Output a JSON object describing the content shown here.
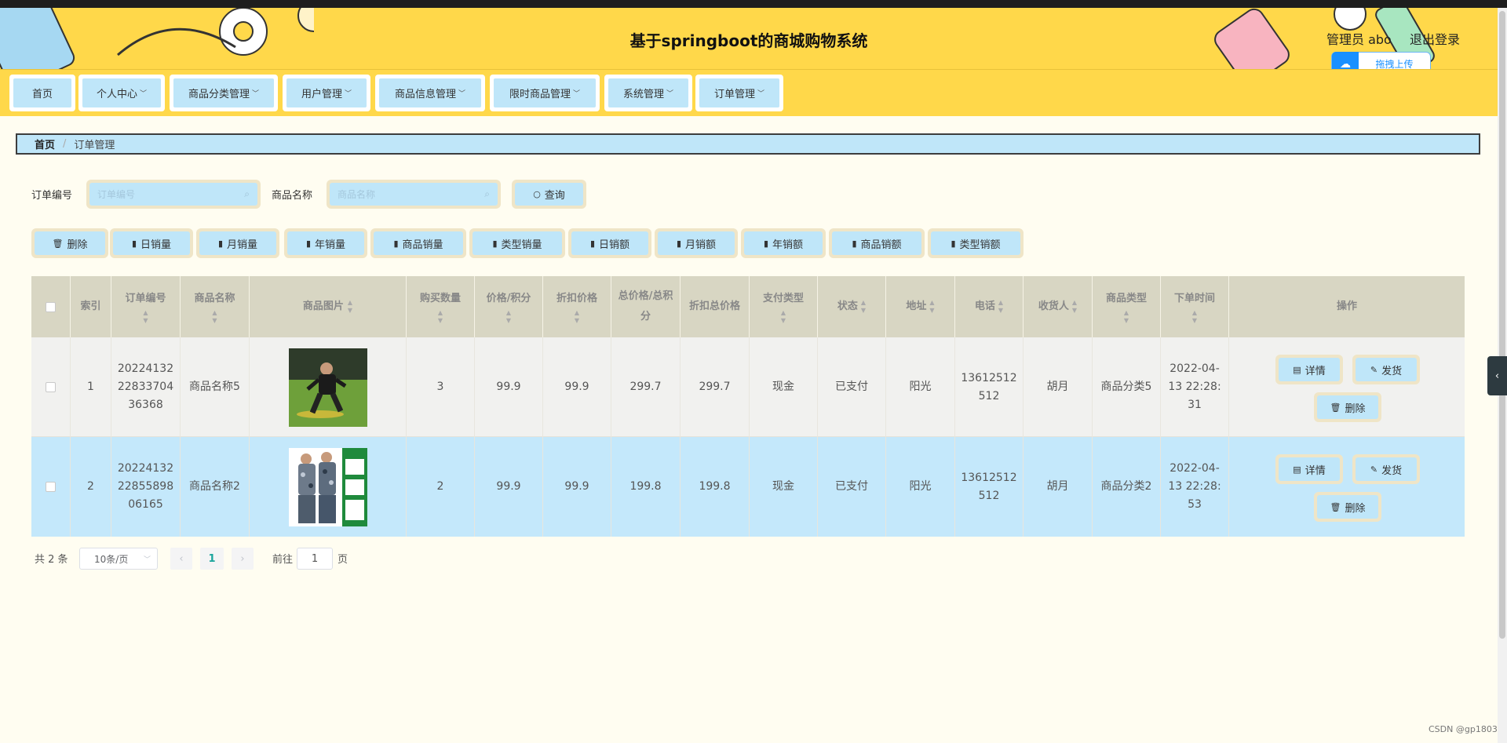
{
  "header": {
    "title": "基于springboot的商城购物系统",
    "user": "管理员 abo",
    "logout": "退出登录",
    "upload_label": "拖拽上传"
  },
  "nav": {
    "items": [
      {
        "label": "首页",
        "dropdown": false
      },
      {
        "label": "个人中心",
        "dropdown": true
      },
      {
        "label": "商品分类管理",
        "dropdown": true
      },
      {
        "label": "用户管理",
        "dropdown": true
      },
      {
        "label": "商品信息管理",
        "dropdown": true
      },
      {
        "label": "限时商品管理",
        "dropdown": true
      },
      {
        "label": "系统管理",
        "dropdown": true
      },
      {
        "label": "订单管理",
        "dropdown": true
      }
    ]
  },
  "breadcrumb": {
    "home": "首页",
    "separator": "/",
    "current": "订单管理"
  },
  "search": {
    "order_no_label": "订单编号",
    "order_no_placeholder": "订单编号",
    "product_name_label": "商品名称",
    "product_name_placeholder": "商品名称",
    "query_label": "查询"
  },
  "actions": {
    "buttons": [
      {
        "label": "删除",
        "icon": "trash-icon"
      },
      {
        "label": "日销量",
        "icon": "bar-chart-icon"
      },
      {
        "label": "月销量",
        "icon": "bar-chart-icon"
      },
      {
        "label": "年销量",
        "icon": "bar-chart-icon"
      },
      {
        "label": "商品销量",
        "icon": "bar-chart-icon"
      },
      {
        "label": "类型销量",
        "icon": "bar-chart-icon"
      },
      {
        "label": "日销额",
        "icon": "bar-chart-icon"
      },
      {
        "label": "月销额",
        "icon": "bar-chart-icon"
      },
      {
        "label": "年销额",
        "icon": "bar-chart-icon"
      },
      {
        "label": "商品销额",
        "icon": "bar-chart-icon"
      },
      {
        "label": "类型销额",
        "icon": "bar-chart-icon"
      }
    ]
  },
  "table": {
    "columns": [
      {
        "label": "",
        "sortable": false
      },
      {
        "label": "索引",
        "sortable": false
      },
      {
        "label": "订单编号",
        "sortable": true
      },
      {
        "label": "商品名称",
        "sortable": true
      },
      {
        "label": "商品图片",
        "sortable": true
      },
      {
        "label": "购买数量",
        "sortable": true
      },
      {
        "label": "价格/积分",
        "sortable": true
      },
      {
        "label": "折扣价格",
        "sortable": true
      },
      {
        "label": "总价格/总积分",
        "sortable": true
      },
      {
        "label": "折扣总价格",
        "sortable": true
      },
      {
        "label": "支付类型",
        "sortable": true
      },
      {
        "label": "状态",
        "sortable": true
      },
      {
        "label": "地址",
        "sortable": true
      },
      {
        "label": "电话",
        "sortable": true
      },
      {
        "label": "收货人",
        "sortable": true
      },
      {
        "label": "商品类型",
        "sortable": true
      },
      {
        "label": "下单时间",
        "sortable": true
      },
      {
        "label": "操作",
        "sortable": false
      }
    ],
    "rows": [
      {
        "index": "1",
        "order_no": "20224132228337043636 8",
        "order_no_lines": [
          "20224132",
          "22833704",
          "36368"
        ],
        "product_name": "商品名称5",
        "quantity": "3",
        "price": "99.9",
        "discount_price": "99.9",
        "total": "299.7",
        "discount_total": "299.7",
        "pay_type": "现金",
        "status": "已支付",
        "address": "阳光",
        "phone_lines": [
          "13612512",
          "512"
        ],
        "receiver": "胡月",
        "category": "商品分类5",
        "time_lines": [
          "2022-04-",
          "13 22:28:",
          "31"
        ],
        "btn_detail": "详情",
        "btn_ship": "发货",
        "btn_delete": "删除"
      },
      {
        "index": "2",
        "order_no_lines": [
          "20224132",
          "22855898",
          "06165"
        ],
        "product_name": "商品名称2",
        "quantity": "2",
        "price": "99.9",
        "discount_price": "99.9",
        "total": "199.8",
        "discount_total": "199.8",
        "pay_type": "现金",
        "status": "已支付",
        "address": "阳光",
        "phone_lines": [
          "13612512",
          "512"
        ],
        "receiver": "胡月",
        "category": "商品分类2",
        "time_lines": [
          "2022-04-",
          "13 22:28:",
          "53"
        ],
        "btn_detail": "详情",
        "btn_ship": "发货",
        "btn_delete": "删除"
      }
    ]
  },
  "pagination": {
    "total": "共 2 条",
    "page_size": "10条/页",
    "current_page": "1",
    "goto_label": "前往",
    "goto_value": "1",
    "page_unit": "页"
  },
  "watermark": "CSDN @gp1803",
  "colors": {
    "header_bg": "#ffd84a",
    "button_bg": "#bfe6f9",
    "button_border": "#efe5c7",
    "selected_row": "#c4e8fb",
    "table_head": "#d8d6c3"
  }
}
